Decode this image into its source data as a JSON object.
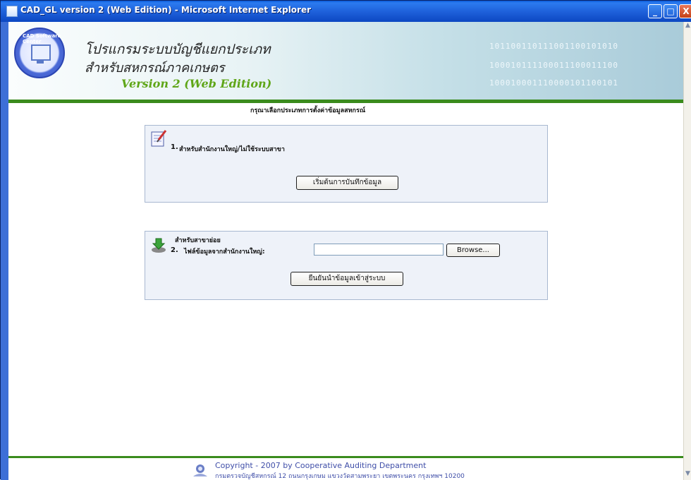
{
  "window": {
    "title": "CAD_GL version 2 (Web Edition) - Microsoft Internet Explorer",
    "controls": {
      "minimize": "_",
      "maximize": "□",
      "close": "X"
    }
  },
  "header": {
    "logo_text": "CAD Software Center",
    "thai_title_line1": "โปรแกรมระบบบัญชีแยกประเภท",
    "thai_title_line2": "สำหรับสหกรณ์ภาคเกษตร",
    "version": "Version 2 (Web Edition)",
    "binary_rows": [
      "101100110111001100101010",
      "100010111100011100011100",
      "100010001110000101100101"
    ]
  },
  "main": {
    "instruction": "กรุณาเลือกประเภทการตั้งค่าข้อมูลสหกรณ์",
    "option1": {
      "number": "1.",
      "label": "สำหรับสำนักงานใหญ่/ไม่ใช้ระบบสาขา",
      "button_label": "เริ่มต้นการบันทึกข้อมูล"
    },
    "option2": {
      "title": "สำหรับสาขาย่อย",
      "number": "2.",
      "file_label": "ไฟล์ข้อมูลจากสำนักงานใหญ่:",
      "file_value": "",
      "browse_label": "Browse...",
      "button_label": "ยืนยันนำข้อมูลเข้าสู่ระบบ"
    }
  },
  "footer": {
    "copyright": "Copyright - 2007 by Cooperative Auditing Department",
    "address": "กรมตรวจบัญชีสหกรณ์ 12 ถนนกรุงเกษม แขวงวัดสามพระยา เขตพระนคร กรุงเทพฯ 10200"
  },
  "colors": {
    "title_bar": "#1d5fd9",
    "accent_green": "#3a8b1d",
    "panel_bg": "#eef2f9",
    "footer_text": "#3f4ea8"
  }
}
